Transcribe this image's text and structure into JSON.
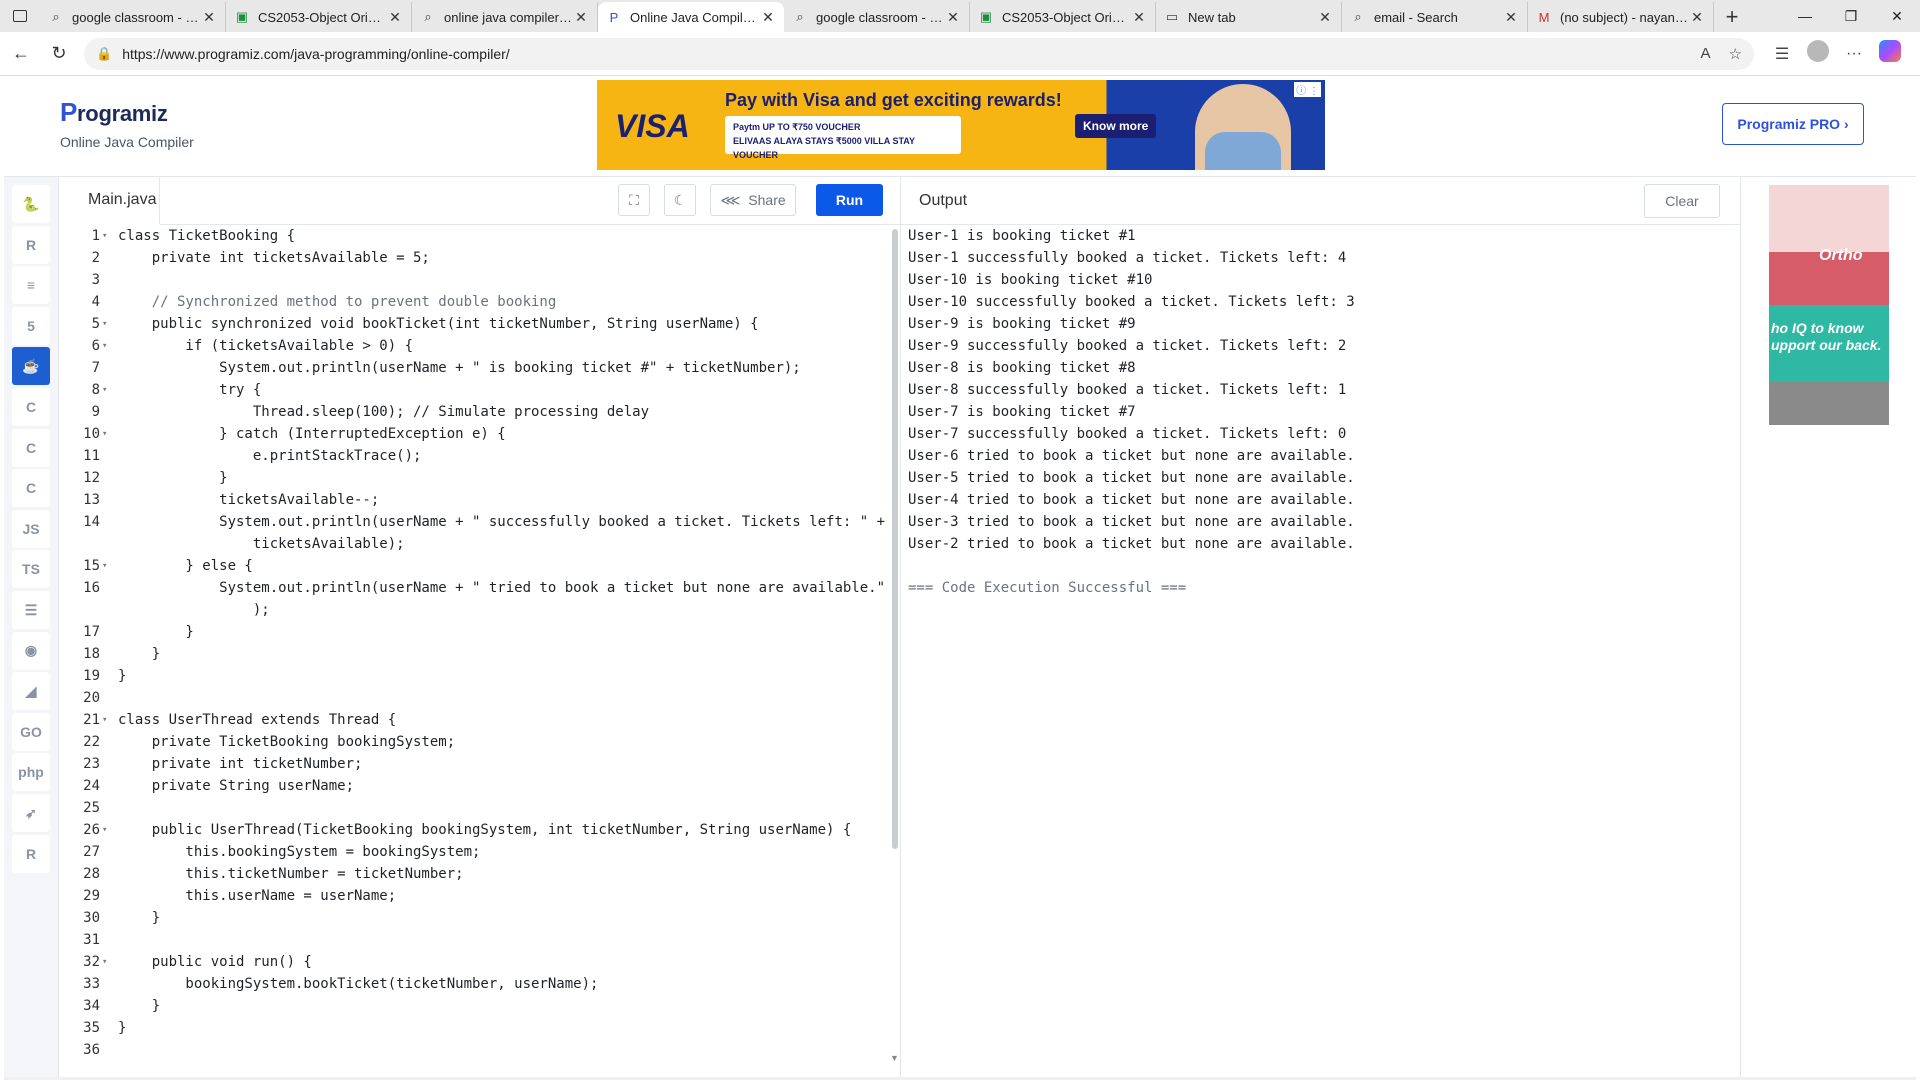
{
  "browser": {
    "tabs": [
      {
        "title": "google classroom - Se",
        "icon": "search-icon",
        "active": false
      },
      {
        "title": "CS2053-Object Oriente",
        "icon": "classroom-icon",
        "active": false
      },
      {
        "title": "online java compiler - S",
        "icon": "search-icon",
        "active": false
      },
      {
        "title": "Online Java Compiler - ",
        "icon": "programiz-icon",
        "active": true
      },
      {
        "title": "google classroom - Se",
        "icon": "search-icon",
        "active": false
      },
      {
        "title": "CS2053-Object Oriente",
        "icon": "classroom-icon",
        "active": false
      },
      {
        "title": "New tab",
        "icon": "newtab-icon",
        "active": false
      },
      {
        "title": "email - Search",
        "icon": "search-icon",
        "active": false
      },
      {
        "title": "(no subject) - nayanarb",
        "icon": "gmail-icon",
        "active": false
      }
    ],
    "url": "https://www.programiz.com/java-programming/online-compiler/"
  },
  "header": {
    "brand": "rogramiz",
    "brand_initial": "P",
    "subtitle": "Online Java Compiler",
    "pro_button": "Programiz PRO ›"
  },
  "ad": {
    "headline": "Pay with Visa and get exciting rewards!",
    "logo": "VISA",
    "voucher_line1": "Paytm  UP TO ₹750 VOUCHER",
    "voucher_line2": "ELIVAAS  ALAYA STAYS  ₹5000 VILLA STAY VOUCHER",
    "cta": "Know more"
  },
  "side_ad": {
    "word1": "Ortho",
    "text": "ho IQ to know upport our back."
  },
  "languages": [
    {
      "name": "python-icon",
      "label": "🐍"
    },
    {
      "name": "r-icon",
      "label": "R"
    },
    {
      "name": "sql-icon",
      "label": "≡"
    },
    {
      "name": "html-icon",
      "label": "5"
    },
    {
      "name": "java-icon",
      "label": "☕"
    },
    {
      "name": "c-icon",
      "label": "C"
    },
    {
      "name": "cpp-icon",
      "label": "C"
    },
    {
      "name": "csharp-icon",
      "label": "C"
    },
    {
      "name": "js-icon",
      "label": "JS"
    },
    {
      "name": "ts-icon",
      "label": "TS"
    },
    {
      "name": "db-icon",
      "label": "☰"
    },
    {
      "name": "rust-icon",
      "label": "◉"
    },
    {
      "name": "kotlin-icon",
      "label": "◢"
    },
    {
      "name": "go-icon",
      "label": "GO"
    },
    {
      "name": "php-icon",
      "label": "php"
    },
    {
      "name": "swift-icon",
      "label": "➶"
    },
    {
      "name": "rlang-icon",
      "label": "R"
    }
  ],
  "editor": {
    "file_tab": "Main.java",
    "share_label": "Share",
    "run_label": "Run",
    "lines": [
      {
        "n": "1",
        "fold": true,
        "text": "class TicketBooking {"
      },
      {
        "n": "2",
        "fold": false,
        "text": "    private int ticketsAvailable = 5;"
      },
      {
        "n": "3",
        "fold": false,
        "text": ""
      },
      {
        "n": "4",
        "fold": false,
        "text": "    // Synchronized method to prevent double booking"
      },
      {
        "n": "5",
        "fold": true,
        "text": "    public synchronized void bookTicket(int ticketNumber, String userName) {"
      },
      {
        "n": "6",
        "fold": true,
        "text": "        if (ticketsAvailable > 0) {"
      },
      {
        "n": "7",
        "fold": false,
        "text": "            System.out.println(userName + \" is booking ticket #\" + ticketNumber);"
      },
      {
        "n": "8",
        "fold": true,
        "text": "            try {"
      },
      {
        "n": "9",
        "fold": false,
        "text": "                Thread.sleep(100); // Simulate processing delay"
      },
      {
        "n": "10",
        "fold": true,
        "text": "            } catch (InterruptedException e) {"
      },
      {
        "n": "11",
        "fold": false,
        "text": "                e.printStackTrace();"
      },
      {
        "n": "12",
        "fold": false,
        "text": "            }"
      },
      {
        "n": "13",
        "fold": false,
        "text": "            ticketsAvailable--;"
      },
      {
        "n": "14",
        "fold": false,
        "text": "            System.out.println(userName + \" successfully booked a ticket. Tickets left: \" +"
      },
      {
        "n": "",
        "fold": false,
        "text": "                ticketsAvailable);"
      },
      {
        "n": "15",
        "fold": true,
        "text": "        } else {"
      },
      {
        "n": "16",
        "fold": false,
        "text": "            System.out.println(userName + \" tried to book a ticket but none are available.\""
      },
      {
        "n": "",
        "fold": false,
        "text": "                );"
      },
      {
        "n": "17",
        "fold": false,
        "text": "        }"
      },
      {
        "n": "18",
        "fold": false,
        "text": "    }"
      },
      {
        "n": "19",
        "fold": false,
        "text": "}"
      },
      {
        "n": "20",
        "fold": false,
        "text": ""
      },
      {
        "n": "21",
        "fold": true,
        "text": "class UserThread extends Thread {"
      },
      {
        "n": "22",
        "fold": false,
        "text": "    private TicketBooking bookingSystem;"
      },
      {
        "n": "23",
        "fold": false,
        "text": "    private int ticketNumber;"
      },
      {
        "n": "24",
        "fold": false,
        "text": "    private String userName;"
      },
      {
        "n": "25",
        "fold": false,
        "text": ""
      },
      {
        "n": "26",
        "fold": true,
        "text": "    public UserThread(TicketBooking bookingSystem, int ticketNumber, String userName) {"
      },
      {
        "n": "27",
        "fold": false,
        "text": "        this.bookingSystem = bookingSystem;"
      },
      {
        "n": "28",
        "fold": false,
        "text": "        this.ticketNumber = ticketNumber;"
      },
      {
        "n": "29",
        "fold": false,
        "text": "        this.userName = userName;"
      },
      {
        "n": "30",
        "fold": false,
        "text": "    }"
      },
      {
        "n": "31",
        "fold": false,
        "text": ""
      },
      {
        "n": "32",
        "fold": true,
        "text": "    public void run() {"
      },
      {
        "n": "33",
        "fold": false,
        "text": "        bookingSystem.bookTicket(ticketNumber, userName);"
      },
      {
        "n": "34",
        "fold": false,
        "text": "    }"
      },
      {
        "n": "35",
        "fold": false,
        "text": "}"
      },
      {
        "n": "36",
        "fold": false,
        "text": ""
      }
    ]
  },
  "output": {
    "title": "Output",
    "clear_label": "Clear",
    "lines": [
      "User-1 is booking ticket #1",
      "User-1 successfully booked a ticket. Tickets left: 4",
      "User-10 is booking ticket #10",
      "User-10 successfully booked a ticket. Tickets left: 3",
      "User-9 is booking ticket #9",
      "User-9 successfully booked a ticket. Tickets left: 2",
      "User-8 is booking ticket #8",
      "User-8 successfully booked a ticket. Tickets left: 1",
      "User-7 is booking ticket #7",
      "User-7 successfully booked a ticket. Tickets left: 0",
      "User-6 tried to book a ticket but none are available.",
      "User-5 tried to book a ticket but none are available.",
      "User-4 tried to book a ticket but none are available.",
      "User-3 tried to book a ticket but none are available.",
      "User-2 tried to book a ticket but none are available.",
      "",
      "=== Code Execution Successful ==="
    ]
  }
}
